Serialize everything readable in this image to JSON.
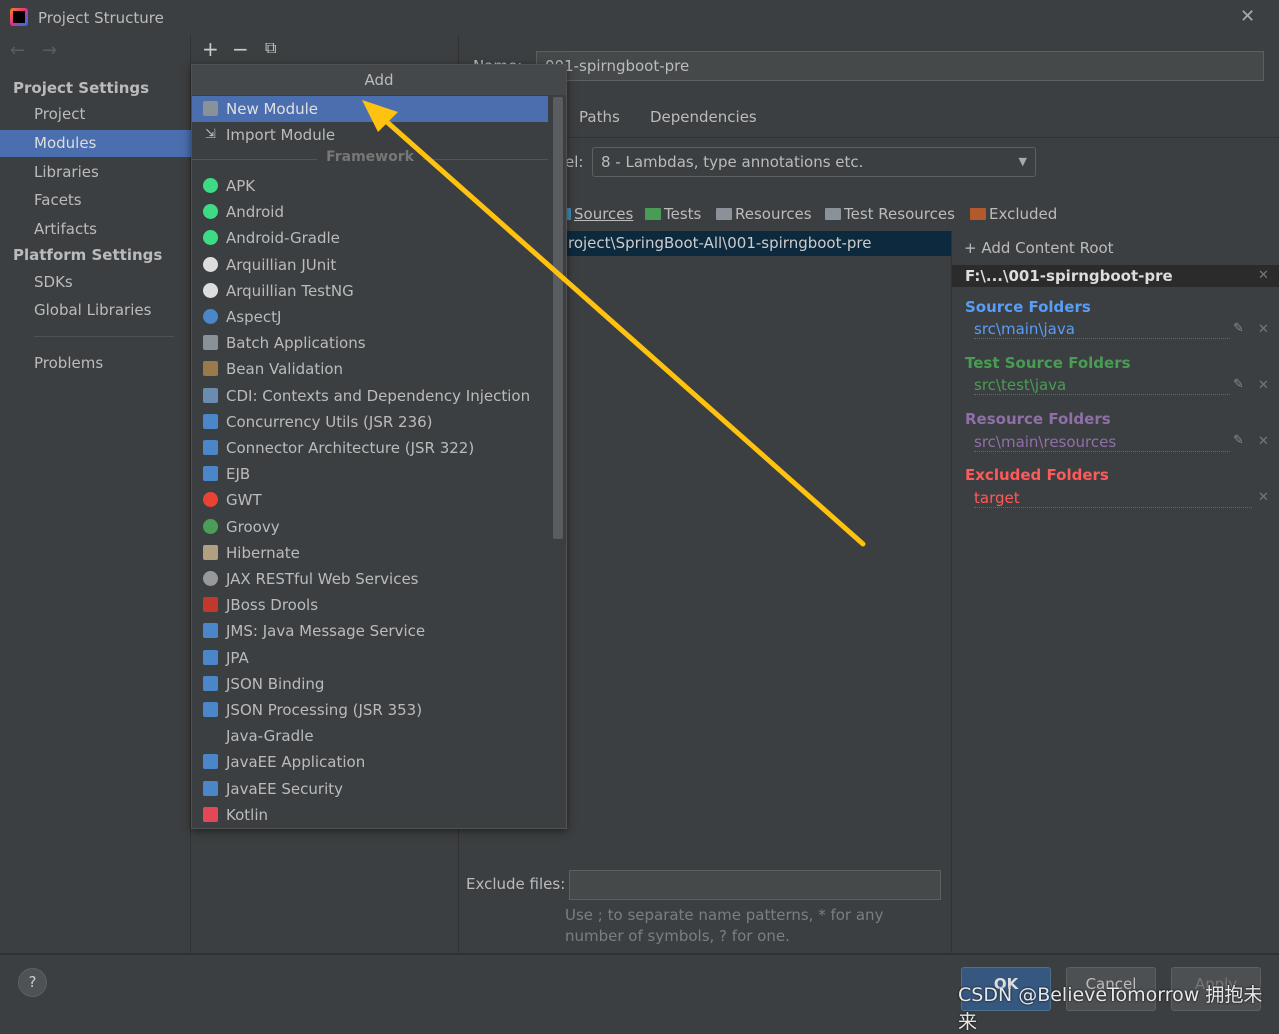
{
  "window": {
    "title": "Project Structure"
  },
  "sidebar": {
    "section1": "Project Settings",
    "items1": [
      {
        "label": "Project"
      },
      {
        "label": "Modules",
        "selected": true
      },
      {
        "label": "Libraries"
      },
      {
        "label": "Facets"
      },
      {
        "label": "Artifacts"
      }
    ],
    "section2": "Platform Settings",
    "items2": [
      {
        "label": "SDKs"
      },
      {
        "label": "Global Libraries"
      }
    ],
    "problems": "Problems"
  },
  "toolbar": {
    "add": "+",
    "remove": "−"
  },
  "module": {
    "name_label": "Name:",
    "name": "001-spirngboot-pre",
    "tabs": [
      "Paths",
      "Dependencies"
    ],
    "language_label": "el:",
    "language_level": "8 - Lambdas, type annotations etc.",
    "mark_as": [
      {
        "label": "Sources",
        "color": "#3d8fb8"
      },
      {
        "label": "Tests",
        "color": "#499c54"
      },
      {
        "label": "Resources",
        "color": "#8a9199"
      },
      {
        "label": "Test Resources",
        "color": "#8a9199"
      },
      {
        "label": "Excluded",
        "color": "#b35a2b"
      }
    ],
    "content_root_path": "roject\\SpringBoot-All\\001-spirngboot-pre",
    "add_content_root": "Add Content Root",
    "root_header": "F:\\...\\001-spirngboot-pre",
    "folders": [
      {
        "heading": "Source Folders",
        "path": "src\\main\\java",
        "color": "#589df6"
      },
      {
        "heading": "Test Source Folders",
        "path": "src\\test\\java",
        "color": "#499c54"
      },
      {
        "heading": "Resource Folders",
        "path": "src\\main\\resources",
        "color": "#8f6fa8"
      },
      {
        "heading": "Excluded Folders",
        "path": "target",
        "color": "#ff5a5a"
      }
    ],
    "exclude_label": "Exclude files:",
    "exclude_value": "",
    "hint": "Use ; to separate name patterns, * for any number of symbols, ? for one."
  },
  "popup": {
    "title": "Add",
    "top_items": [
      {
        "label": "New Module",
        "icon": "folder-module-icon",
        "selected": true
      },
      {
        "label": "Import Module",
        "icon": "import-icon"
      }
    ],
    "separator": "Framework",
    "items": [
      {
        "label": "APK",
        "icon": "android-icon",
        "color": "#3ddc84"
      },
      {
        "label": "Android",
        "icon": "android-icon",
        "color": "#3ddc84"
      },
      {
        "label": "Android-Gradle",
        "icon": "android-icon",
        "color": "#3ddc84"
      },
      {
        "label": "Arquillian JUnit",
        "icon": "arquillian-icon",
        "color": "#dddddd"
      },
      {
        "label": "Arquillian TestNG",
        "icon": "arquillian-icon",
        "color": "#dddddd"
      },
      {
        "label": "AspectJ",
        "icon": "aspectj-icon",
        "color": "#4a86c8"
      },
      {
        "label": "Batch Applications",
        "icon": "folder-icon",
        "color": "#8a9199"
      },
      {
        "label": "Bean Validation",
        "icon": "bean-icon",
        "color": "#9b7a4a"
      },
      {
        "label": "CDI: Contexts and Dependency Injection",
        "icon": "cdi-icon",
        "color": "#6a8caf"
      },
      {
        "label": "Concurrency Utils (JSR 236)",
        "icon": "javaee-icon",
        "color": "#4a86c8"
      },
      {
        "label": "Connector Architecture (JSR 322)",
        "icon": "javaee-icon",
        "color": "#4a86c8"
      },
      {
        "label": "EJB",
        "icon": "javaee-icon",
        "color": "#4a86c8"
      },
      {
        "label": "GWT",
        "icon": "google-icon",
        "color": "#ea4335"
      },
      {
        "label": "Groovy",
        "icon": "groovy-icon",
        "color": "#4b9e58"
      },
      {
        "label": "Hibernate",
        "icon": "hibernate-icon",
        "color": "#b0a080"
      },
      {
        "label": "JAX RESTful Web Services",
        "icon": "globe-icon",
        "color": "#999999"
      },
      {
        "label": "JBoss Drools",
        "icon": "drools-icon",
        "color": "#c0392b"
      },
      {
        "label": "JMS: Java Message Service",
        "icon": "javaee-icon",
        "color": "#4a86c8"
      },
      {
        "label": "JPA",
        "icon": "javaee-icon",
        "color": "#4a86c8"
      },
      {
        "label": "JSON Binding",
        "icon": "javaee-icon",
        "color": "#4a86c8"
      },
      {
        "label": "JSON Processing (JSR 353)",
        "icon": "javaee-icon",
        "color": "#4a86c8"
      },
      {
        "label": "Java-Gradle",
        "icon": "none",
        "color": ""
      },
      {
        "label": "JavaEE Application",
        "icon": "javaee-icon",
        "color": "#4a86c8"
      },
      {
        "label": "JavaEE Security",
        "icon": "javaee-icon",
        "color": "#4a86c8"
      },
      {
        "label": "Kotlin",
        "icon": "kotlin-icon",
        "color": "#e44857"
      }
    ]
  },
  "buttons": {
    "help": "?",
    "ok": "OK",
    "cancel": "Cancel",
    "apply": "Apply"
  },
  "watermark": "CSDN @BelieveTomorrow 拥抱未来",
  "annotation": {
    "arrow_color": "#ffc20e"
  }
}
